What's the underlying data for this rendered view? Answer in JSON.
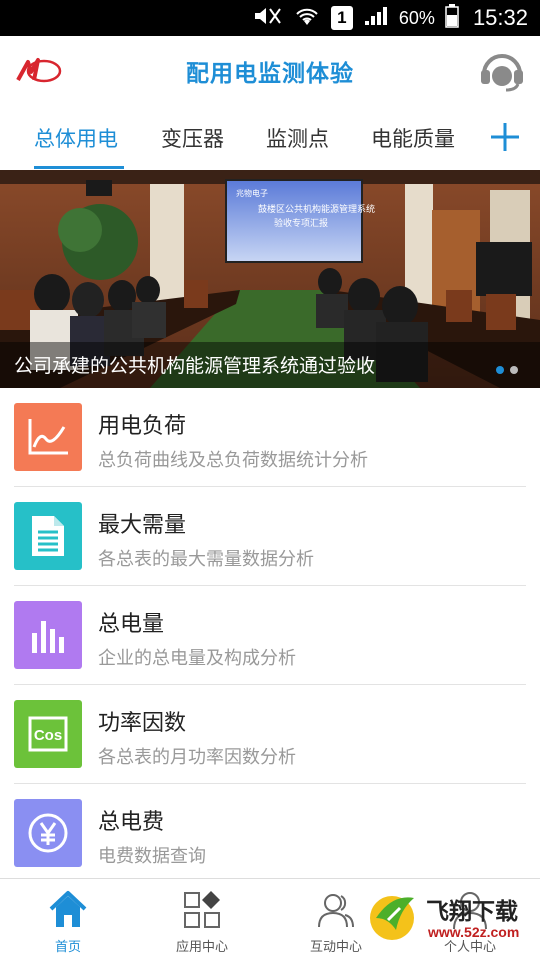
{
  "status_bar": {
    "sim_slot": "1",
    "battery": "60%",
    "time": "15:32"
  },
  "header": {
    "title": "配用电监测体验"
  },
  "tabs": [
    {
      "label": "总体用电",
      "active": true
    },
    {
      "label": "变压器",
      "active": false
    },
    {
      "label": "监测点",
      "active": false
    },
    {
      "label": "电能质量",
      "active": false
    }
  ],
  "banner": {
    "caption": "公司承建的公共机构能源管理系统通过验收",
    "screen_line1": "兆物电子",
    "screen_line2": "鼓楼区公共机构能源管理系统",
    "screen_line3": "验收专项汇报",
    "slide_count": 2,
    "active_slide": 1
  },
  "menu": [
    {
      "title": "用电负荷",
      "desc": "总负荷曲线及总负荷数据统计分析",
      "icon": "line-chart-icon",
      "color": "#f47a55"
    },
    {
      "title": "最大需量",
      "desc": "各总表的最大需量数据分析",
      "icon": "document-icon",
      "color": "#26c0c8"
    },
    {
      "title": "总电量",
      "desc": "企业的总电量及构成分析",
      "icon": "bar-chart-icon",
      "color": "#b07af0"
    },
    {
      "title": "功率因数",
      "desc": "各总表的月功率因数分析",
      "icon": "cos-icon",
      "color": "#6cc23a"
    },
    {
      "title": "总电费",
      "desc": "电费数据查询",
      "icon": "yen-icon",
      "color": "#8a8ff2"
    }
  ],
  "bottom_nav": [
    {
      "label": "首页",
      "icon": "home-icon",
      "active": true
    },
    {
      "label": "应用中心",
      "icon": "apps-icon",
      "active": false
    },
    {
      "label": "互动中心",
      "icon": "users-icon",
      "active": false
    },
    {
      "label": "个人中心",
      "icon": "person-icon",
      "active": false
    }
  ],
  "watermark": {
    "text": "飞翔下载",
    "url": "www.52z.com"
  },
  "colors": {
    "accent": "#1e8ed6"
  }
}
